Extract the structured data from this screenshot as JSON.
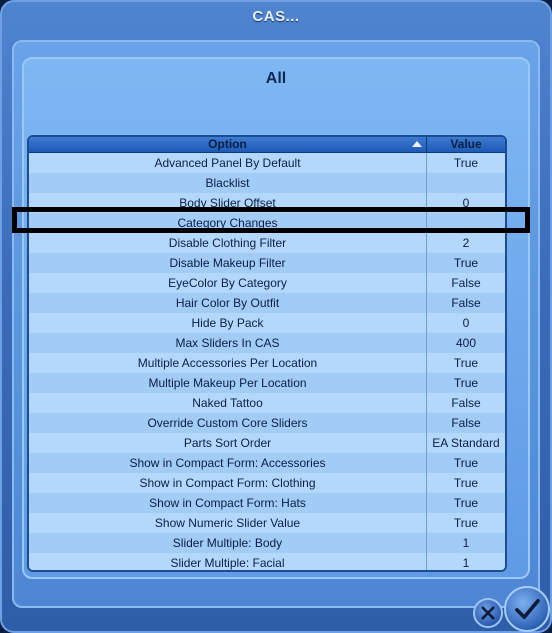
{
  "window": {
    "title": "CAS..."
  },
  "panel": {
    "heading": "All"
  },
  "table": {
    "columns": {
      "option": "Option",
      "value": "Value"
    },
    "rows": [
      {
        "option": "Advanced Panel By Default",
        "value": "True"
      },
      {
        "option": "Blacklist",
        "value": ""
      },
      {
        "option": "Body Slider Offset",
        "value": "0"
      },
      {
        "option": "Category Changes",
        "value": ""
      },
      {
        "option": "Disable Clothing Filter",
        "value": "2"
      },
      {
        "option": "Disable Makeup Filter",
        "value": "True"
      },
      {
        "option": "EyeColor By Category",
        "value": "False"
      },
      {
        "option": "Hair Color By Outfit",
        "value": "False"
      },
      {
        "option": "Hide By Pack",
        "value": "0"
      },
      {
        "option": "Max Sliders In CAS",
        "value": "400"
      },
      {
        "option": "Multiple Accessories Per Location",
        "value": "True"
      },
      {
        "option": "Multiple Makeup Per Location",
        "value": "True"
      },
      {
        "option": "Naked Tattoo",
        "value": "False"
      },
      {
        "option": "Override Custom Core Sliders",
        "value": "False"
      },
      {
        "option": "Parts Sort Order",
        "value": "EA Standard"
      },
      {
        "option": "Show in Compact Form: Accessories",
        "value": "True"
      },
      {
        "option": "Show in Compact Form: Clothing",
        "value": "True"
      },
      {
        "option": "Show in Compact Form: Hats",
        "value": "True"
      },
      {
        "option": "Show Numeric Slider Value",
        "value": "True"
      },
      {
        "option": "Slider Multiple: Body",
        "value": "1"
      },
      {
        "option": "Slider Multiple: Facial",
        "value": "1"
      }
    ]
  },
  "icons": {
    "sort": "sort-ascending-icon",
    "cancel": "close-icon",
    "confirm": "checkmark-icon"
  },
  "colors": {
    "highlight_border": "#000000",
    "accent": "#2f64b8"
  }
}
